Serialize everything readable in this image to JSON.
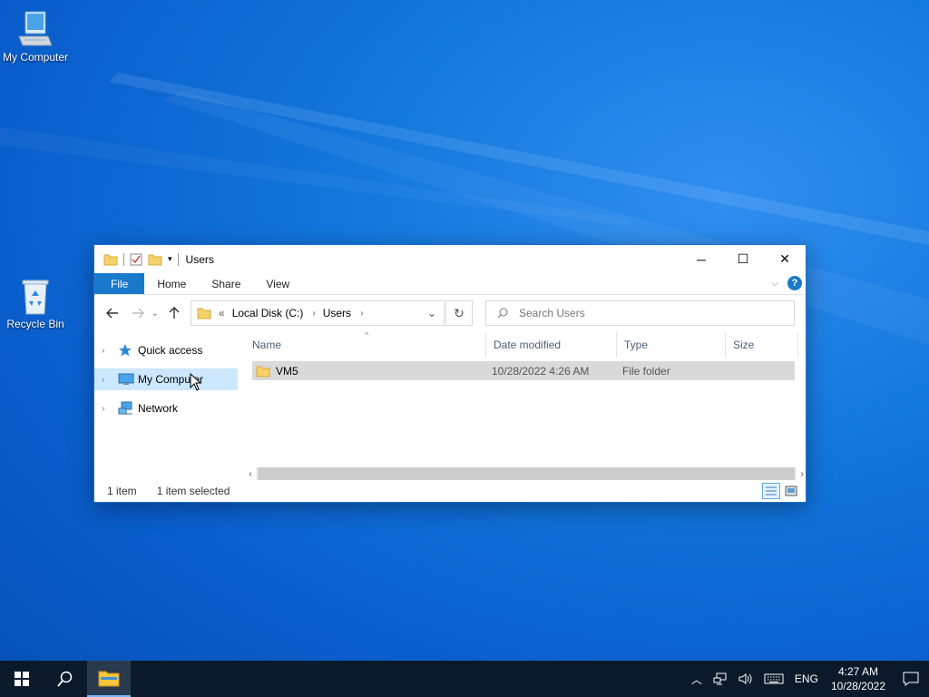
{
  "desktop": {
    "icons": [
      {
        "label": "My Computer",
        "icon": "computer-icon"
      },
      {
        "label": "Recycle Bin",
        "icon": "recycle-bin-icon"
      }
    ]
  },
  "explorer": {
    "title": "Users",
    "window_controls": {
      "minimize": "─",
      "maximize": "☐",
      "close": "✕"
    },
    "ribbon_tabs": [
      "File",
      "Home",
      "Share",
      "View"
    ],
    "help_label": "?",
    "address": {
      "overflow": "«",
      "crumbs": [
        "Local Disk (C:)",
        "Users"
      ],
      "separator": "›"
    },
    "search_placeholder": "Search Users",
    "nav_pane": [
      {
        "label": "Quick access",
        "icon": "star-icon",
        "selected": false
      },
      {
        "label": "My Computer",
        "icon": "computer-icon",
        "selected": true
      },
      {
        "label": "Network",
        "icon": "network-icon",
        "selected": false
      }
    ],
    "columns": [
      "Name",
      "Date modified",
      "Type",
      "Size"
    ],
    "rows": [
      {
        "name": "VM5",
        "date_modified": "10/28/2022 4:26 AM",
        "type": "File folder",
        "size": ""
      }
    ],
    "status": {
      "item_count": "1 item",
      "selection": "1 item selected"
    }
  },
  "taskbar": {
    "pinned": [
      "start-icon",
      "search-icon",
      "file-explorer-icon"
    ],
    "tray": {
      "language": "ENG",
      "time": "4:27 AM",
      "date": "10/28/2022"
    }
  },
  "colors": {
    "accent": "#1979ca",
    "selection": "#cce8ff",
    "row_selected": "#d9d9d9",
    "taskbar": "#0b1a2b"
  }
}
